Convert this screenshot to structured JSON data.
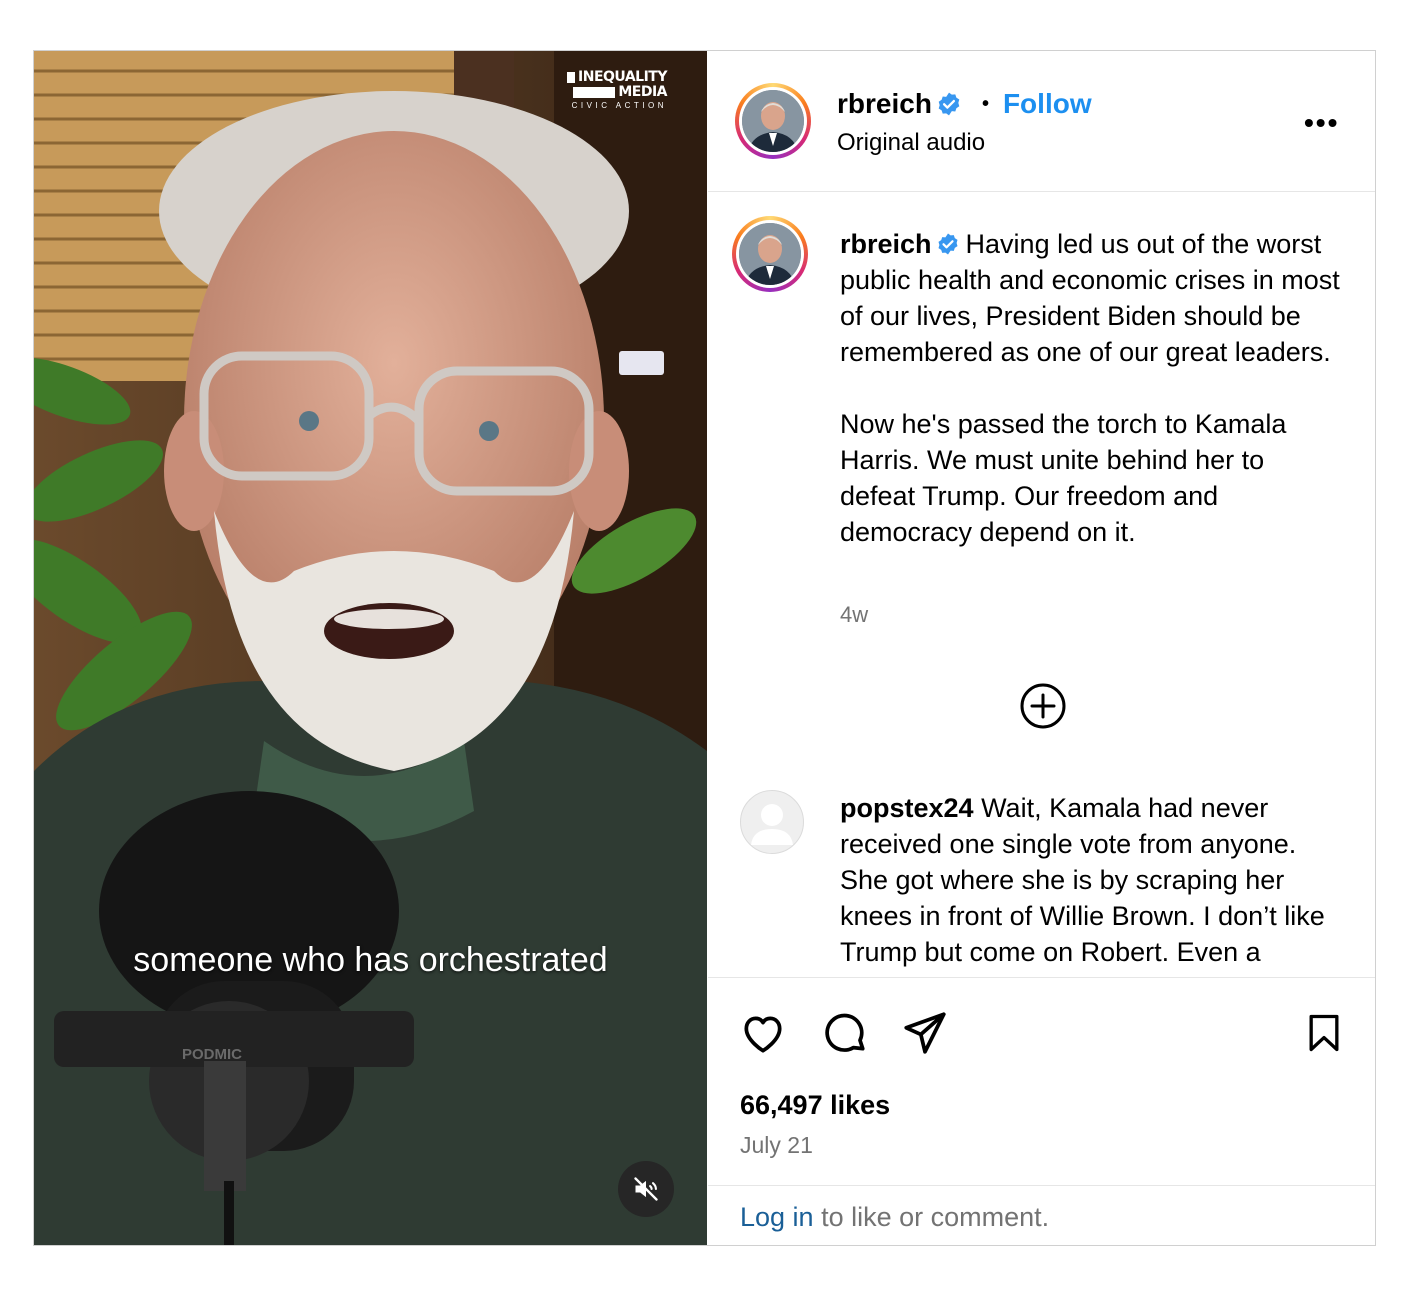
{
  "video": {
    "brand_line1": "INEQUALITY",
    "brand_line2": "MEDIA",
    "brand_line3": "CIVIC ACTION",
    "mic_brand": "PODMIC",
    "caption": "someone who has orchestrated",
    "mute_icon": "speaker-muted-icon"
  },
  "header": {
    "username": "rbreich",
    "separator": "•",
    "follow_label": "Follow",
    "audio_label": "Original audio",
    "more_label": "•••"
  },
  "caption": {
    "username": "rbreich",
    "paragraph1": "Having led us out of the worst public health and economic crises in most of our lives, President Biden should be remembered as one of our great leaders.",
    "paragraph2": "Now he's passed the torch to Kamala Harris. We must unite behind her to defeat Trump. Our freedom and democracy depend on it.",
    "time_ago": "4w"
  },
  "comment": {
    "username": "popstex24",
    "text": "Wait, Kamala had never received one single vote from anyone. She got where she is by scraping her knees in front of Willie Brown. I don’t like Trump but come on Robert. Even a"
  },
  "actions": {
    "likes": "66,497 likes",
    "date": "July 21",
    "login_link": "Log in",
    "login_rest": " to like or comment."
  },
  "colors": {
    "link_blue": "#1c8ff0",
    "verified_blue": "#3897f0",
    "muted_text": "#737373"
  }
}
